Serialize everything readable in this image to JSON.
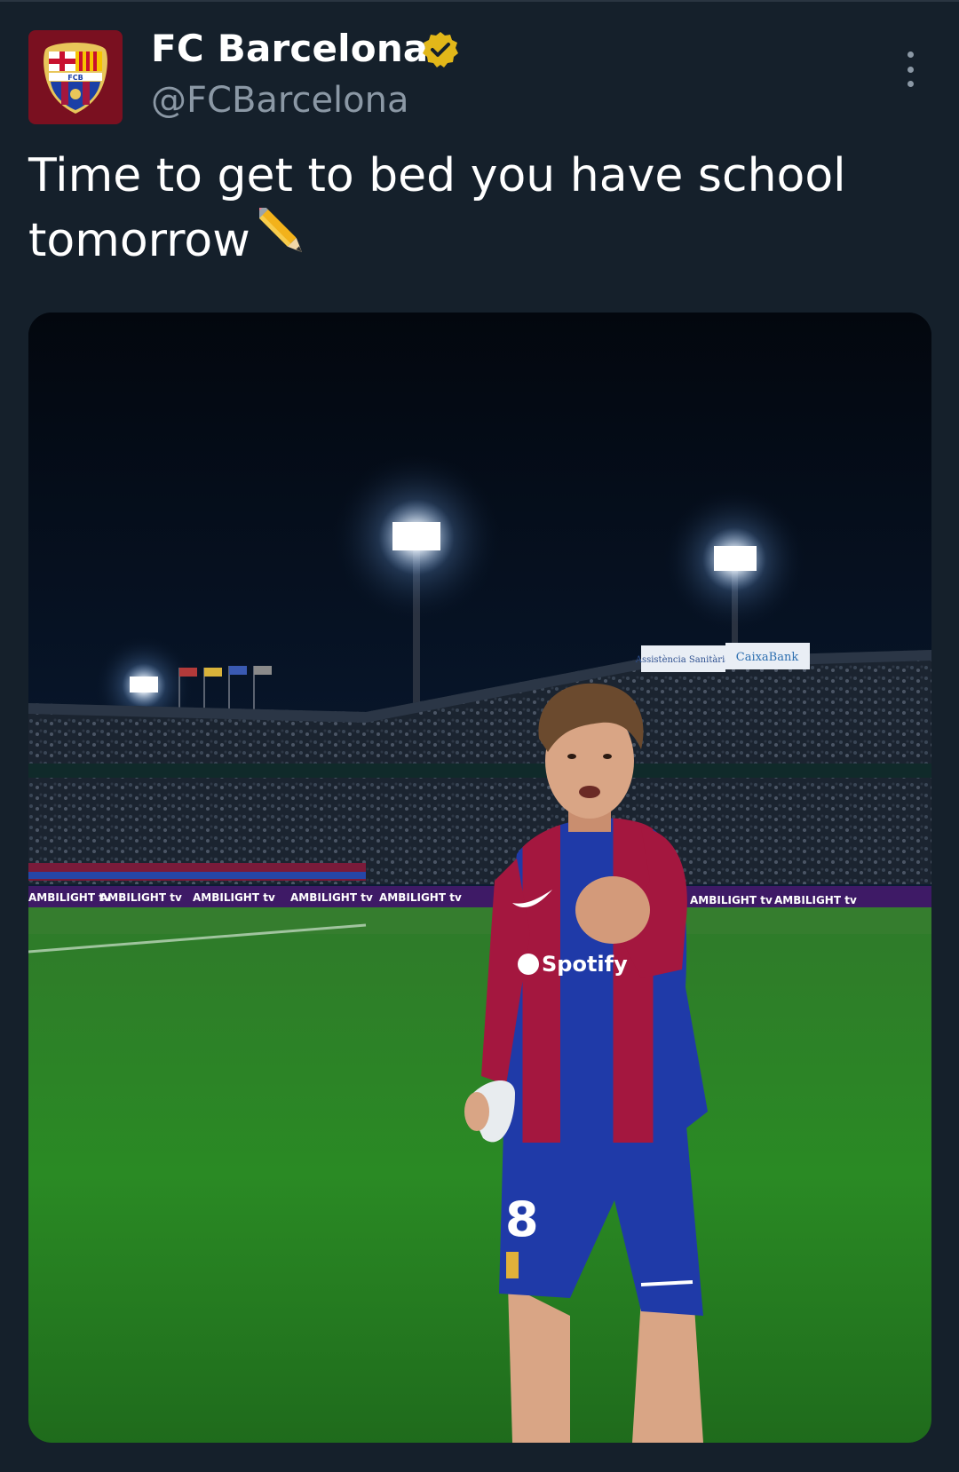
{
  "tweet": {
    "author": {
      "name": "FC Barcelona",
      "handle": "@FCBarcelona",
      "verified": true,
      "badge_color": "#e2b719"
    },
    "text": "Time to get to bed you have school tomorrow",
    "emoji": "pencil-emoji"
  },
  "photo": {
    "board_text": "AMBILIGHT tv",
    "sponsor": "Spotify",
    "shirt_number": "8",
    "sign_left": "Assistència Sanitària",
    "sign_right": "CaixaBank"
  },
  "colors": {
    "background": "#15202b",
    "text_primary": "#ffffff",
    "text_secondary": "#8b98a5",
    "barca_blue": "#1b3fa6",
    "barca_red": "#a4173f"
  }
}
